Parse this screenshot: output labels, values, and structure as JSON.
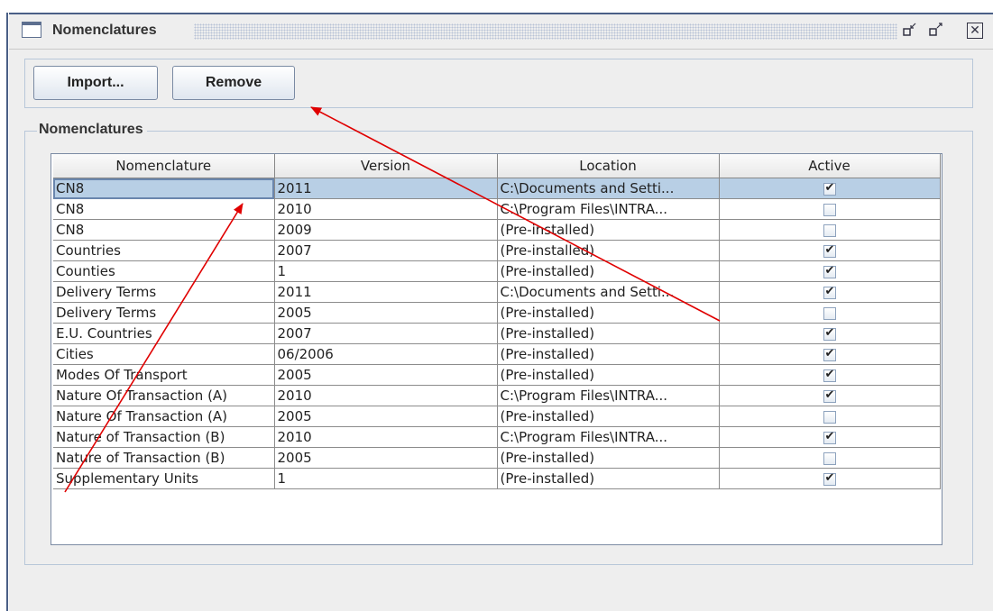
{
  "window": {
    "title": "Nomenclatures",
    "controls": {
      "minimize_icon": "restore-down-icon",
      "maximize_icon": "maximize-icon",
      "close_icon": "close-icon"
    }
  },
  "toolbar": {
    "import_label": "Import...",
    "remove_label": "Remove"
  },
  "group": {
    "title": "Nomenclatures"
  },
  "table": {
    "columns": [
      "Nomenclature",
      "Version",
      "Location",
      "Active"
    ],
    "rows": [
      {
        "nomenclature": "CN8",
        "version": "2011",
        "location": "C:\\Documents and Setti...",
        "active": true,
        "selected": true
      },
      {
        "nomenclature": "CN8",
        "version": "2010",
        "location": "C:\\Program Files\\INTRA...",
        "active": false
      },
      {
        "nomenclature": "CN8",
        "version": "2009",
        "location": "(Pre-installed)",
        "active": false
      },
      {
        "nomenclature": "Countries",
        "version": "2007",
        "location": "(Pre-installed)",
        "active": true
      },
      {
        "nomenclature": "Counties",
        "version": "1",
        "location": "(Pre-installed)",
        "active": true
      },
      {
        "nomenclature": "Delivery Terms",
        "version": "2011",
        "location": "C:\\Documents and Setti...",
        "active": true
      },
      {
        "nomenclature": "Delivery Terms",
        "version": "2005",
        "location": "(Pre-installed)",
        "active": false
      },
      {
        "nomenclature": "E.U. Countries",
        "version": "2007",
        "location": "(Pre-installed)",
        "active": true
      },
      {
        "nomenclature": "Cities",
        "version": "06/2006",
        "location": "(Pre-installed)",
        "active": true
      },
      {
        "nomenclature": "Modes Of Transport",
        "version": "2005",
        "location": "(Pre-installed)",
        "active": true
      },
      {
        "nomenclature": "Nature Of Transaction (A)",
        "version": "2010",
        "location": "C:\\Program Files\\INTRA...",
        "active": true
      },
      {
        "nomenclature": "Nature Of Transaction (A)",
        "version": "2005",
        "location": "(Pre-installed)",
        "active": false
      },
      {
        "nomenclature": "Nature of Transaction (B)",
        "version": "2010",
        "location": "C:\\Program Files\\INTRA...",
        "active": true
      },
      {
        "nomenclature": "Nature of Transaction (B)",
        "version": "2005",
        "location": "(Pre-installed)",
        "active": false
      },
      {
        "nomenclature": "Supplementary Units",
        "version": "1",
        "location": "(Pre-installed)",
        "active": true
      }
    ]
  },
  "colors": {
    "selection": "#b8cfe5",
    "annotation_arrow": "#e00000",
    "frame_border": "#4a5f86"
  }
}
